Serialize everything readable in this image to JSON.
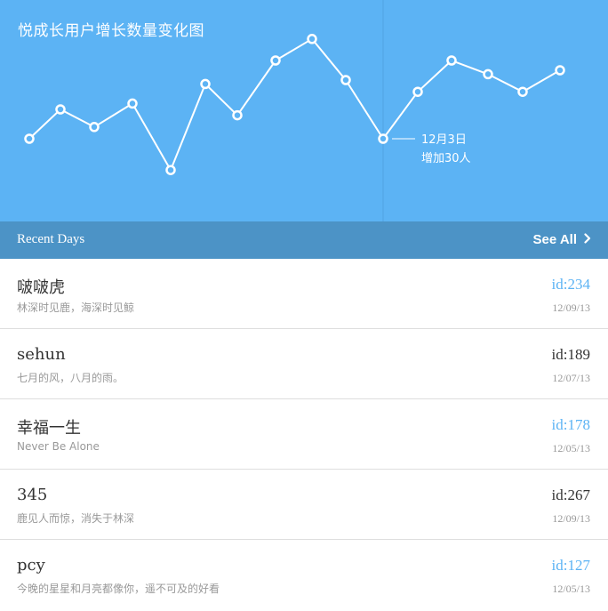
{
  "chart": {
    "title": "悦成长用户增长数量变化图",
    "tooltip": {
      "date": "12月3日",
      "text": "增加30人"
    },
    "line_color": "#ffffff",
    "background": "#5cb3f4",
    "highlight_index": 10
  },
  "chart_data": {
    "type": "line",
    "title": "悦成长用户增长数量变化图",
    "xlabel": "",
    "ylabel": "",
    "grid": false,
    "series": [
      {
        "values": [
          60,
          75,
          66,
          78,
          44,
          88,
          72,
          100,
          111,
          90,
          60,
          84,
          100,
          93,
          84,
          95
        ]
      }
    ],
    "ylim": [
      40,
      115
    ]
  },
  "header": {
    "recent_label": "Recent Days",
    "see_all_label": "See All"
  },
  "items": [
    {
      "name": "啵啵虎",
      "subtitle": "林深时见鹿，海深时见鲸",
      "id": "id:234",
      "date": "12/09/13",
      "id_color": "#5cb3f4"
    },
    {
      "name": "sehun",
      "subtitle": "七月的风，八月的雨。",
      "id": "id:189",
      "date": "12/07/13",
      "id_color": "#333333"
    },
    {
      "name": "幸福一生",
      "subtitle": "Never Be Alone",
      "id": "id:178",
      "date": "12/05/13",
      "id_color": "#5cb3f4"
    },
    {
      "name": "345",
      "subtitle": "鹿见人而惊，消失于林深",
      "id": "id:267",
      "date": "12/09/13",
      "id_color": "#333333"
    },
    {
      "name": "pcy",
      "subtitle": "今晚的星星和月亮都像你，遥不可及的好看",
      "id": "id:127",
      "date": "12/05/13",
      "id_color": "#5cb3f4"
    }
  ]
}
